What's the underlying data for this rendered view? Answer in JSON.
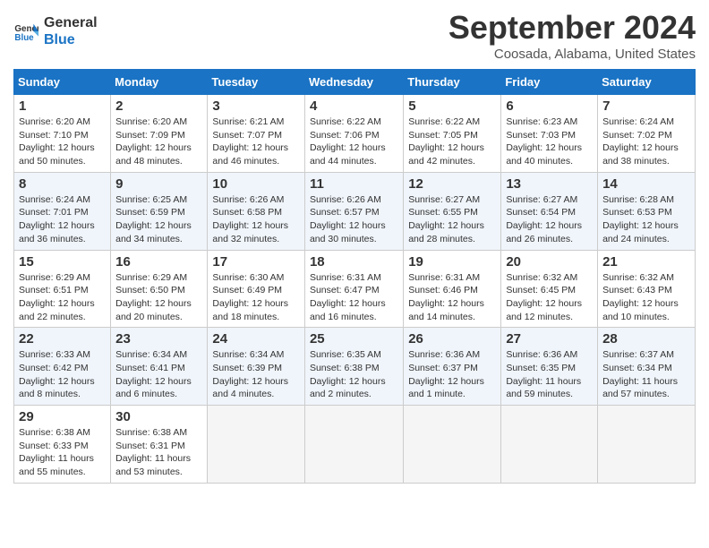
{
  "logo": {
    "line1": "General",
    "line2": "Blue"
  },
  "title": "September 2024",
  "location": "Coosada, Alabama, United States",
  "days_of_week": [
    "Sunday",
    "Monday",
    "Tuesday",
    "Wednesday",
    "Thursday",
    "Friday",
    "Saturday"
  ],
  "weeks": [
    [
      {
        "day": "1",
        "info": "Sunrise: 6:20 AM\nSunset: 7:10 PM\nDaylight: 12 hours\nand 50 minutes."
      },
      {
        "day": "2",
        "info": "Sunrise: 6:20 AM\nSunset: 7:09 PM\nDaylight: 12 hours\nand 48 minutes."
      },
      {
        "day": "3",
        "info": "Sunrise: 6:21 AM\nSunset: 7:07 PM\nDaylight: 12 hours\nand 46 minutes."
      },
      {
        "day": "4",
        "info": "Sunrise: 6:22 AM\nSunset: 7:06 PM\nDaylight: 12 hours\nand 44 minutes."
      },
      {
        "day": "5",
        "info": "Sunrise: 6:22 AM\nSunset: 7:05 PM\nDaylight: 12 hours\nand 42 minutes."
      },
      {
        "day": "6",
        "info": "Sunrise: 6:23 AM\nSunset: 7:03 PM\nDaylight: 12 hours\nand 40 minutes."
      },
      {
        "day": "7",
        "info": "Sunrise: 6:24 AM\nSunset: 7:02 PM\nDaylight: 12 hours\nand 38 minutes."
      }
    ],
    [
      {
        "day": "8",
        "info": "Sunrise: 6:24 AM\nSunset: 7:01 PM\nDaylight: 12 hours\nand 36 minutes."
      },
      {
        "day": "9",
        "info": "Sunrise: 6:25 AM\nSunset: 6:59 PM\nDaylight: 12 hours\nand 34 minutes."
      },
      {
        "day": "10",
        "info": "Sunrise: 6:26 AM\nSunset: 6:58 PM\nDaylight: 12 hours\nand 32 minutes."
      },
      {
        "day": "11",
        "info": "Sunrise: 6:26 AM\nSunset: 6:57 PM\nDaylight: 12 hours\nand 30 minutes."
      },
      {
        "day": "12",
        "info": "Sunrise: 6:27 AM\nSunset: 6:55 PM\nDaylight: 12 hours\nand 28 minutes."
      },
      {
        "day": "13",
        "info": "Sunrise: 6:27 AM\nSunset: 6:54 PM\nDaylight: 12 hours\nand 26 minutes."
      },
      {
        "day": "14",
        "info": "Sunrise: 6:28 AM\nSunset: 6:53 PM\nDaylight: 12 hours\nand 24 minutes."
      }
    ],
    [
      {
        "day": "15",
        "info": "Sunrise: 6:29 AM\nSunset: 6:51 PM\nDaylight: 12 hours\nand 22 minutes."
      },
      {
        "day": "16",
        "info": "Sunrise: 6:29 AM\nSunset: 6:50 PM\nDaylight: 12 hours\nand 20 minutes."
      },
      {
        "day": "17",
        "info": "Sunrise: 6:30 AM\nSunset: 6:49 PM\nDaylight: 12 hours\nand 18 minutes."
      },
      {
        "day": "18",
        "info": "Sunrise: 6:31 AM\nSunset: 6:47 PM\nDaylight: 12 hours\nand 16 minutes."
      },
      {
        "day": "19",
        "info": "Sunrise: 6:31 AM\nSunset: 6:46 PM\nDaylight: 12 hours\nand 14 minutes."
      },
      {
        "day": "20",
        "info": "Sunrise: 6:32 AM\nSunset: 6:45 PM\nDaylight: 12 hours\nand 12 minutes."
      },
      {
        "day": "21",
        "info": "Sunrise: 6:32 AM\nSunset: 6:43 PM\nDaylight: 12 hours\nand 10 minutes."
      }
    ],
    [
      {
        "day": "22",
        "info": "Sunrise: 6:33 AM\nSunset: 6:42 PM\nDaylight: 12 hours\nand 8 minutes."
      },
      {
        "day": "23",
        "info": "Sunrise: 6:34 AM\nSunset: 6:41 PM\nDaylight: 12 hours\nand 6 minutes."
      },
      {
        "day": "24",
        "info": "Sunrise: 6:34 AM\nSunset: 6:39 PM\nDaylight: 12 hours\nand 4 minutes."
      },
      {
        "day": "25",
        "info": "Sunrise: 6:35 AM\nSunset: 6:38 PM\nDaylight: 12 hours\nand 2 minutes."
      },
      {
        "day": "26",
        "info": "Sunrise: 6:36 AM\nSunset: 6:37 PM\nDaylight: 12 hours\nand 1 minute."
      },
      {
        "day": "27",
        "info": "Sunrise: 6:36 AM\nSunset: 6:35 PM\nDaylight: 11 hours\nand 59 minutes."
      },
      {
        "day": "28",
        "info": "Sunrise: 6:37 AM\nSunset: 6:34 PM\nDaylight: 11 hours\nand 57 minutes."
      }
    ],
    [
      {
        "day": "29",
        "info": "Sunrise: 6:38 AM\nSunset: 6:33 PM\nDaylight: 11 hours\nand 55 minutes."
      },
      {
        "day": "30",
        "info": "Sunrise: 6:38 AM\nSunset: 6:31 PM\nDaylight: 11 hours\nand 53 minutes."
      },
      null,
      null,
      null,
      null,
      null
    ]
  ]
}
